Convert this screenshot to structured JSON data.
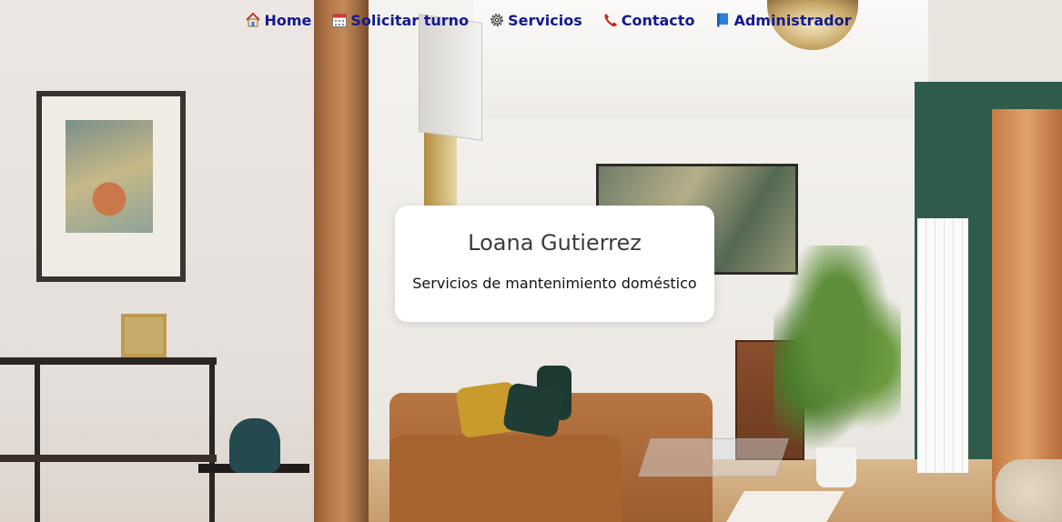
{
  "nav": {
    "items": [
      {
        "label": "Home",
        "icon": "house-icon"
      },
      {
        "label": "Solicitar turno",
        "icon": "calendar-icon"
      },
      {
        "label": "Servicios",
        "icon": "gear-icon"
      },
      {
        "label": "Contacto",
        "icon": "telephone-icon"
      },
      {
        "label": "Administrador",
        "icon": "book-icon"
      }
    ]
  },
  "hero": {
    "title": "Loana Gutierrez",
    "subtitle": "Servicios de mantenimiento doméstico"
  },
  "colors": {
    "nav_link": "#151a8c",
    "card_bg": "#ffffff",
    "title_text": "#3c3c3c"
  }
}
